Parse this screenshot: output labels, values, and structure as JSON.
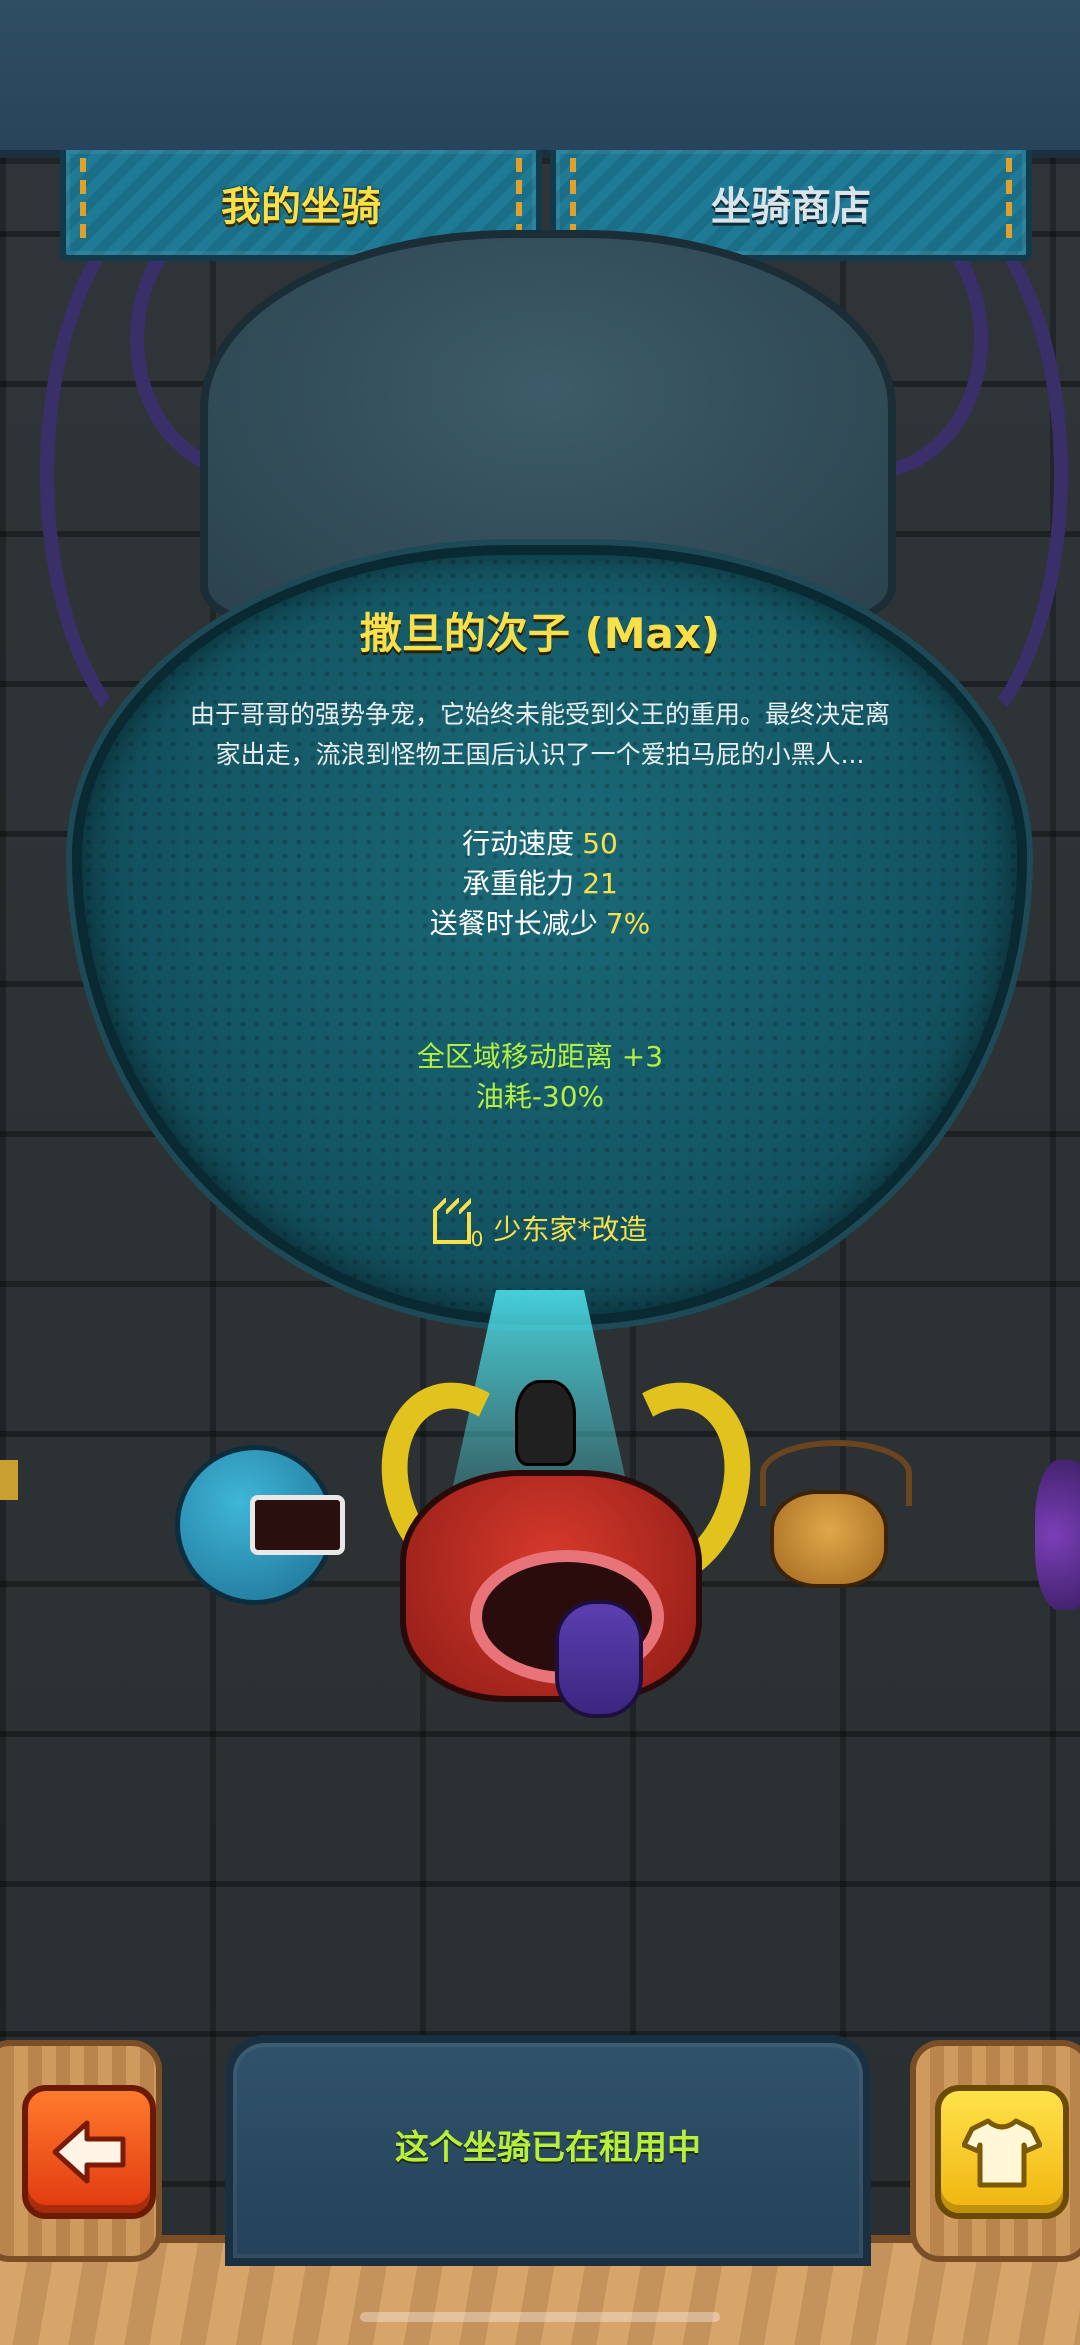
{
  "tabs": {
    "my_mounts": "我的坐骑",
    "mount_shop": "坐骑商店"
  },
  "mount": {
    "name": "撒旦的次子 (Max)",
    "description_line1": "由于哥哥的强势争宠，它始终未能受到父王的重用。最终决定离",
    "description_line2": "家出走，流浪到怪物王国后认识了一个爱拍马屁的小黑人...",
    "stats": [
      {
        "label": "行动速度",
        "value": "50"
      },
      {
        "label": "承重能力",
        "value": "21"
      },
      {
        "label": "送餐时长减少",
        "value": "7%"
      }
    ],
    "bonuses": [
      "全区域移动距离 +3",
      "油耗-30%"
    ],
    "badge": {
      "icon": "crown-icon",
      "count": "0",
      "label": "少东家*改造"
    }
  },
  "footer": {
    "status": "这个坐骑已在租用中",
    "back_icon": "arrow-left-icon",
    "skin_icon": "shirt-icon"
  },
  "colors": {
    "title_yellow": "#f7e04a",
    "bonus_green": "#b4f040",
    "back_orange": "#e0380f",
    "skin_yellow": "#f0b40e"
  }
}
